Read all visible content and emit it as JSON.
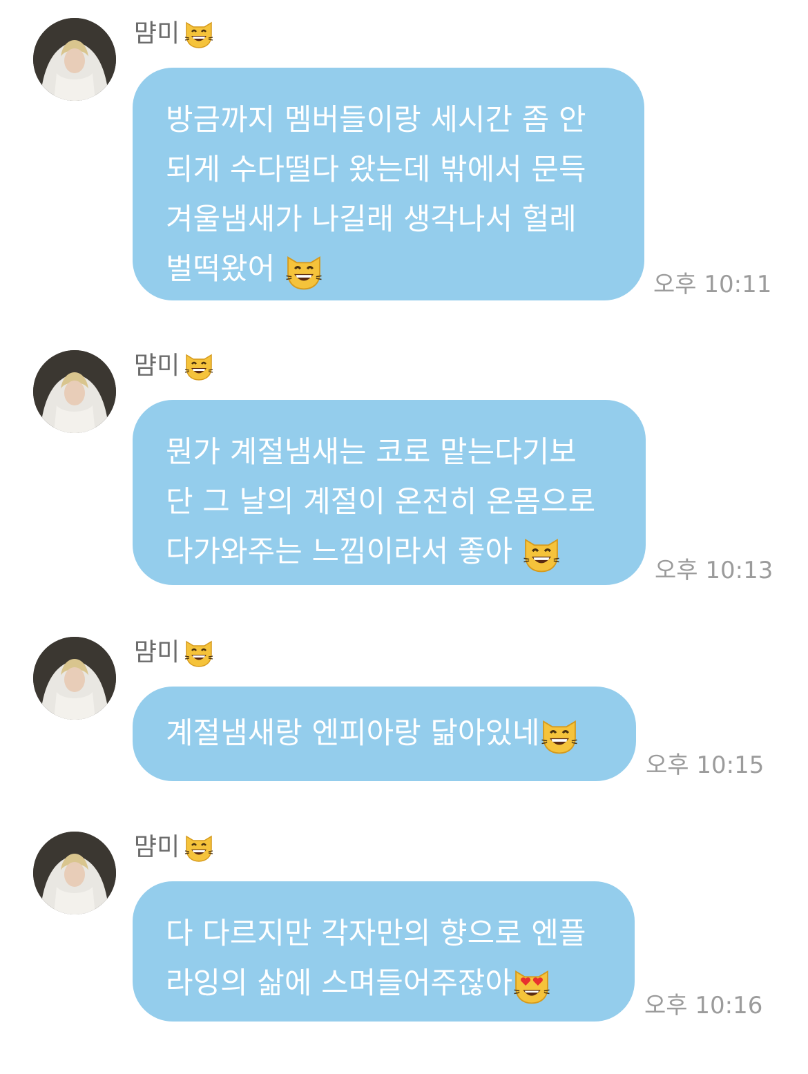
{
  "colors": {
    "bubble": "#94cdec",
    "bubble_text": "#ffffff",
    "sender_text": "#6b6b6b",
    "time_text": "#9b9b9b",
    "background": "#ffffff"
  },
  "messages": [
    {
      "sender": "먐미",
      "sender_emoji": "grinning-cat-icon",
      "lines": [
        "방금까지 멤버들이랑 세시간 좀 안",
        "되게 수다떨다 왔는데 밖에서 문득",
        "겨울냄새가 나길래 생각나서 헐레",
        "벌떡왔어"
      ],
      "end_emoji": "grinning-cat-icon",
      "time": "오후 10:11"
    },
    {
      "sender": "먐미",
      "sender_emoji": "grinning-cat-icon",
      "lines": [
        "뭔가 계절냄새는 코로 맡는다기보",
        "단 그 날의 계절이 온전히 온몸으로",
        "다가와주는 느낌이라서 좋아"
      ],
      "end_emoji": "grinning-cat-icon",
      "time": "오후 10:13"
    },
    {
      "sender": "먐미",
      "sender_emoji": "grinning-cat-icon",
      "lines": [
        "계절냄새랑 엔피아랑 닮아있네"
      ],
      "end_emoji": "grinning-cat-icon",
      "time": "오후 10:15"
    },
    {
      "sender": "먐미",
      "sender_emoji": "grinning-cat-icon",
      "lines": [
        "다 다르지만 각자만의 향으로 엔플",
        "라잉의 삶에 스며들어주잖아"
      ],
      "end_emoji": "heart-eyes-cat-icon",
      "time": "오후 10:16"
    }
  ]
}
